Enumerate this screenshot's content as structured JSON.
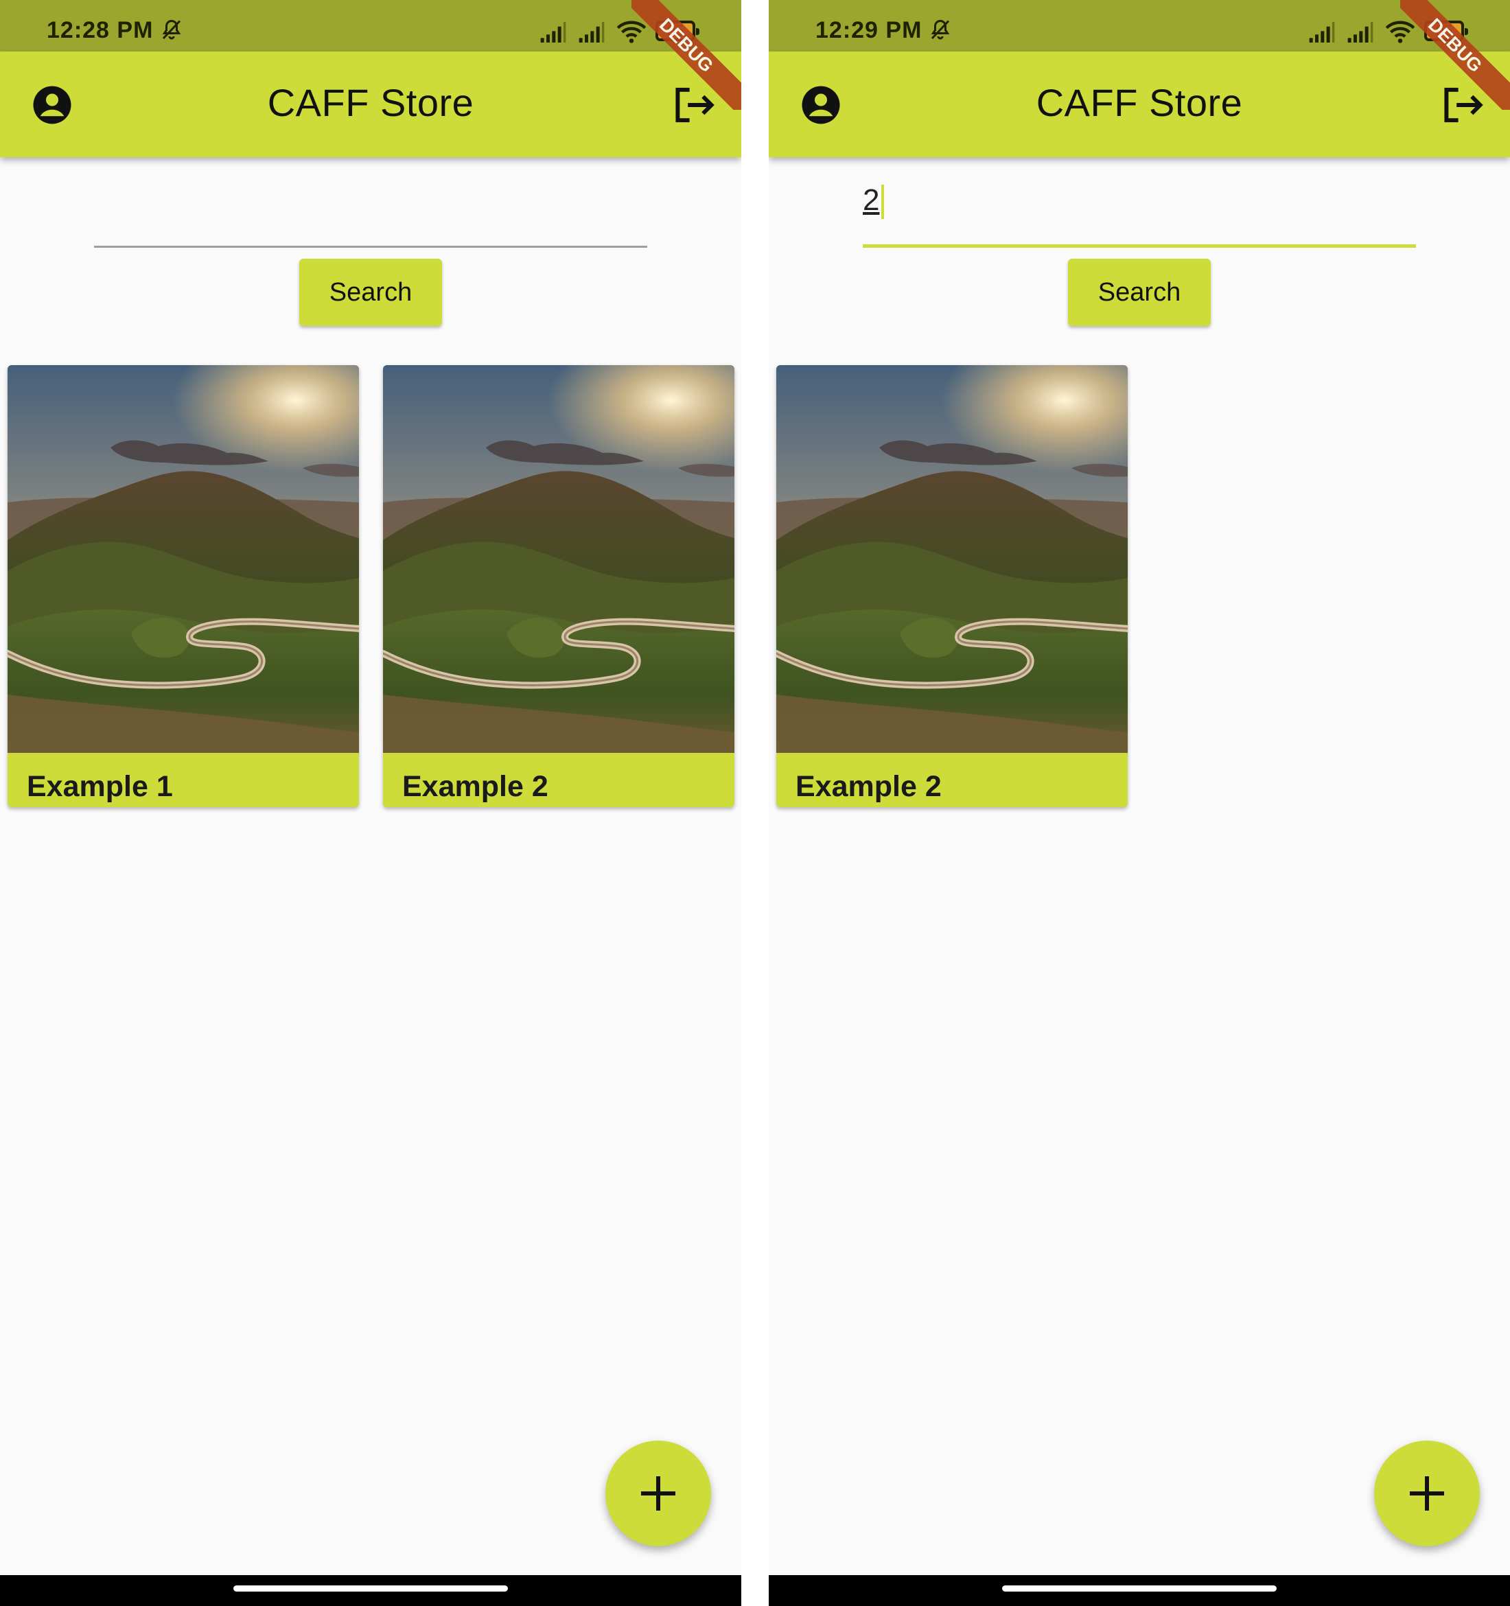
{
  "app_title": "CAFF Store",
  "colors": {
    "primary": "#cddc39",
    "status_bar": "#9aa62e",
    "background": "#fafafa",
    "debug_banner": "#b3421a"
  },
  "screens": [
    {
      "status": {
        "time": "12:28 PM",
        "battery": "95"
      },
      "debug_banner": "DEBUG",
      "search": {
        "value": ""
      },
      "search_button": "Search",
      "results": [
        {
          "title": "Example 1"
        },
        {
          "title": "Example 2"
        }
      ],
      "fab_icon": "plus-icon"
    },
    {
      "status": {
        "time": "12:29 PM",
        "battery": "95"
      },
      "debug_banner": "DEBUG",
      "search": {
        "value": "2"
      },
      "search_button": "Search",
      "results": [
        {
          "title": "Example 2"
        }
      ],
      "fab_icon": "plus-icon"
    }
  ]
}
